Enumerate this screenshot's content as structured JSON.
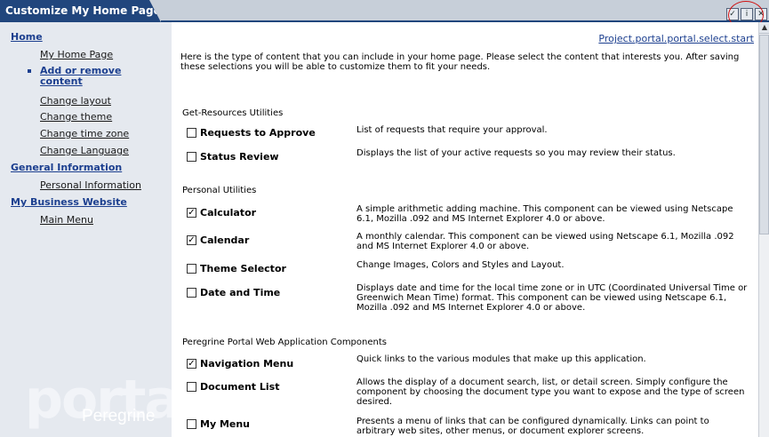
{
  "window": {
    "title": "Customize My Home Page",
    "icons": [
      "checkbox-icon",
      "info-icon",
      "close-icon"
    ]
  },
  "sidebar": {
    "sections": [
      {
        "label": "Home",
        "items": [
          "My Home Page",
          "Add or remove content",
          "Change layout",
          "Change theme",
          "Change time zone",
          "Change Language"
        ]
      },
      {
        "label": "General Information",
        "items": [
          "Personal Information"
        ]
      },
      {
        "label": "My Business Website",
        "items": [
          "Main Menu"
        ]
      }
    ],
    "active_item": "Add or remove content",
    "watermark": "portal",
    "brand": "Peregrine"
  },
  "main": {
    "select_link": "Project.portal.portal.select.start",
    "intro": "Here is the type of content that you can include in your home page. Please select the content that interests you. After saving these selections you will be able to customize them to fit your needs.",
    "groups": [
      {
        "title": "Get-Resources Utilities",
        "items": [
          {
            "name": "Requests to Approve",
            "checked": false,
            "desc": "List of requests that require your approval."
          },
          {
            "name": "Status Review",
            "checked": false,
            "desc": "Displays the list of your active requests so you may review their status."
          }
        ]
      },
      {
        "title": "Personal Utilities",
        "items": [
          {
            "name": "Calculator",
            "checked": true,
            "desc": "A simple arithmetic adding machine. This component can be viewed using Netscape 6.1, Mozilla .092 and MS Internet Explorer 4.0 or above."
          },
          {
            "name": "Calendar",
            "checked": true,
            "desc": "A monthly calendar. This component can be viewed using Netscape 6.1, Mozilla .092 and MS Internet Explorer 4.0 or above."
          },
          {
            "name": "Theme Selector",
            "checked": false,
            "desc": "Change Images, Colors and Styles and Layout."
          },
          {
            "name": "Date and Time",
            "checked": false,
            "desc": "Displays date and time for the local time zone or in UTC (Coordinated Universal Time or Greenwich Mean Time) format. This component can be viewed using Netscape 6.1, Mozilla .092 and MS Internet Explorer 4.0 or above."
          }
        ]
      },
      {
        "title": "Peregrine Portal Web Application Components",
        "items": [
          {
            "name": "Navigation Menu",
            "checked": true,
            "desc": "Quick links to the various modules that make up this application."
          },
          {
            "name": "Document List",
            "checked": false,
            "desc": "Allows the display of a document search, list, or detail screen. Simply configure the component by choosing the document type you want to expose and the type of screen desired."
          },
          {
            "name": "My Menu",
            "checked": false,
            "desc": "Presents a menu of links that can be configured dynamically. Links can point to arbitrary web sites, other menus, or document explorer screens."
          }
        ]
      }
    ]
  }
}
